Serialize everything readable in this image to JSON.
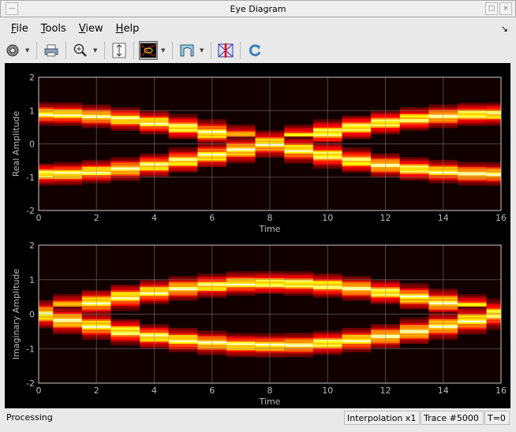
{
  "window": {
    "title": "Eye Diagram"
  },
  "menu": [
    {
      "first": "F",
      "rest": "ile"
    },
    {
      "first": "T",
      "rest": "ools"
    },
    {
      "first": "V",
      "rest": "iew"
    },
    {
      "first": "H",
      "rest": "elp"
    }
  ],
  "toolbar": [
    "gear-icon",
    "print-icon",
    "zoom-in-icon",
    "scale-axes-icon",
    "eye-display-icon",
    "histogram-icon",
    "measurement-icon",
    "refresh-icon"
  ],
  "status": {
    "left": "Processing",
    "interp": "Interpolation x1",
    "trace": "Trace #5000",
    "time": "T=0"
  },
  "colors": {
    "background": "#000000",
    "axis": "#c8c8c8",
    "colormap": "hot"
  },
  "chart_data": [
    {
      "type": "heatmap",
      "title": "",
      "xlabel": "Time",
      "ylabel": "Real Amplitude",
      "xlim": [
        0,
        16
      ],
      "ylim": [
        -2,
        2
      ],
      "xticks": [
        "0",
        "2",
        "4",
        "6",
        "8",
        "10",
        "12",
        "14",
        "16"
      ],
      "yticks": [
        "2",
        "1",
        "0",
        "-1",
        "-2"
      ],
      "grid": true,
      "x": [
        0,
        1,
        2,
        3,
        4,
        5,
        6,
        7,
        8,
        9,
        10,
        11,
        12,
        13,
        14,
        15,
        16
      ],
      "upper_trace_center": [
        0.9,
        0.89,
        0.83,
        0.75,
        0.64,
        0.5,
        0.34,
        0.18,
        0,
        0.18,
        0.34,
        0.5,
        0.64,
        0.75,
        0.83,
        0.89,
        0.9
      ],
      "lower_trace_center": [
        -0.9,
        -0.89,
        -0.83,
        -0.75,
        -0.64,
        -0.5,
        -0.34,
        -0.18,
        0,
        -0.18,
        -0.34,
        -0.5,
        -0.64,
        -0.75,
        -0.83,
        -0.89,
        -0.9
      ]
    },
    {
      "type": "heatmap",
      "title": "",
      "xlabel": "Time",
      "ylabel": "Imaginary Amplitude",
      "xlim": [
        0,
        16
      ],
      "ylim": [
        -2,
        2
      ],
      "xticks": [
        "0",
        "2",
        "4",
        "6",
        "8",
        "10",
        "12",
        "14",
        "16"
      ],
      "yticks": [
        "2",
        "1",
        "0",
        "-1",
        "-2"
      ],
      "grid": true,
      "x": [
        0,
        1,
        2,
        3,
        4,
        5,
        6,
        7,
        8,
        9,
        10,
        11,
        12,
        13,
        14,
        15,
        16
      ],
      "upper_trace_center": [
        0,
        0.18,
        0.34,
        0.5,
        0.64,
        0.75,
        0.83,
        0.89,
        0.9,
        0.89,
        0.83,
        0.75,
        0.64,
        0.5,
        0.34,
        0.18,
        0
      ],
      "lower_trace_center": [
        0,
        -0.18,
        -0.34,
        -0.5,
        -0.64,
        -0.75,
        -0.83,
        -0.89,
        -0.9,
        -0.89,
        -0.83,
        -0.75,
        -0.64,
        -0.5,
        -0.34,
        -0.18,
        0
      ]
    }
  ]
}
